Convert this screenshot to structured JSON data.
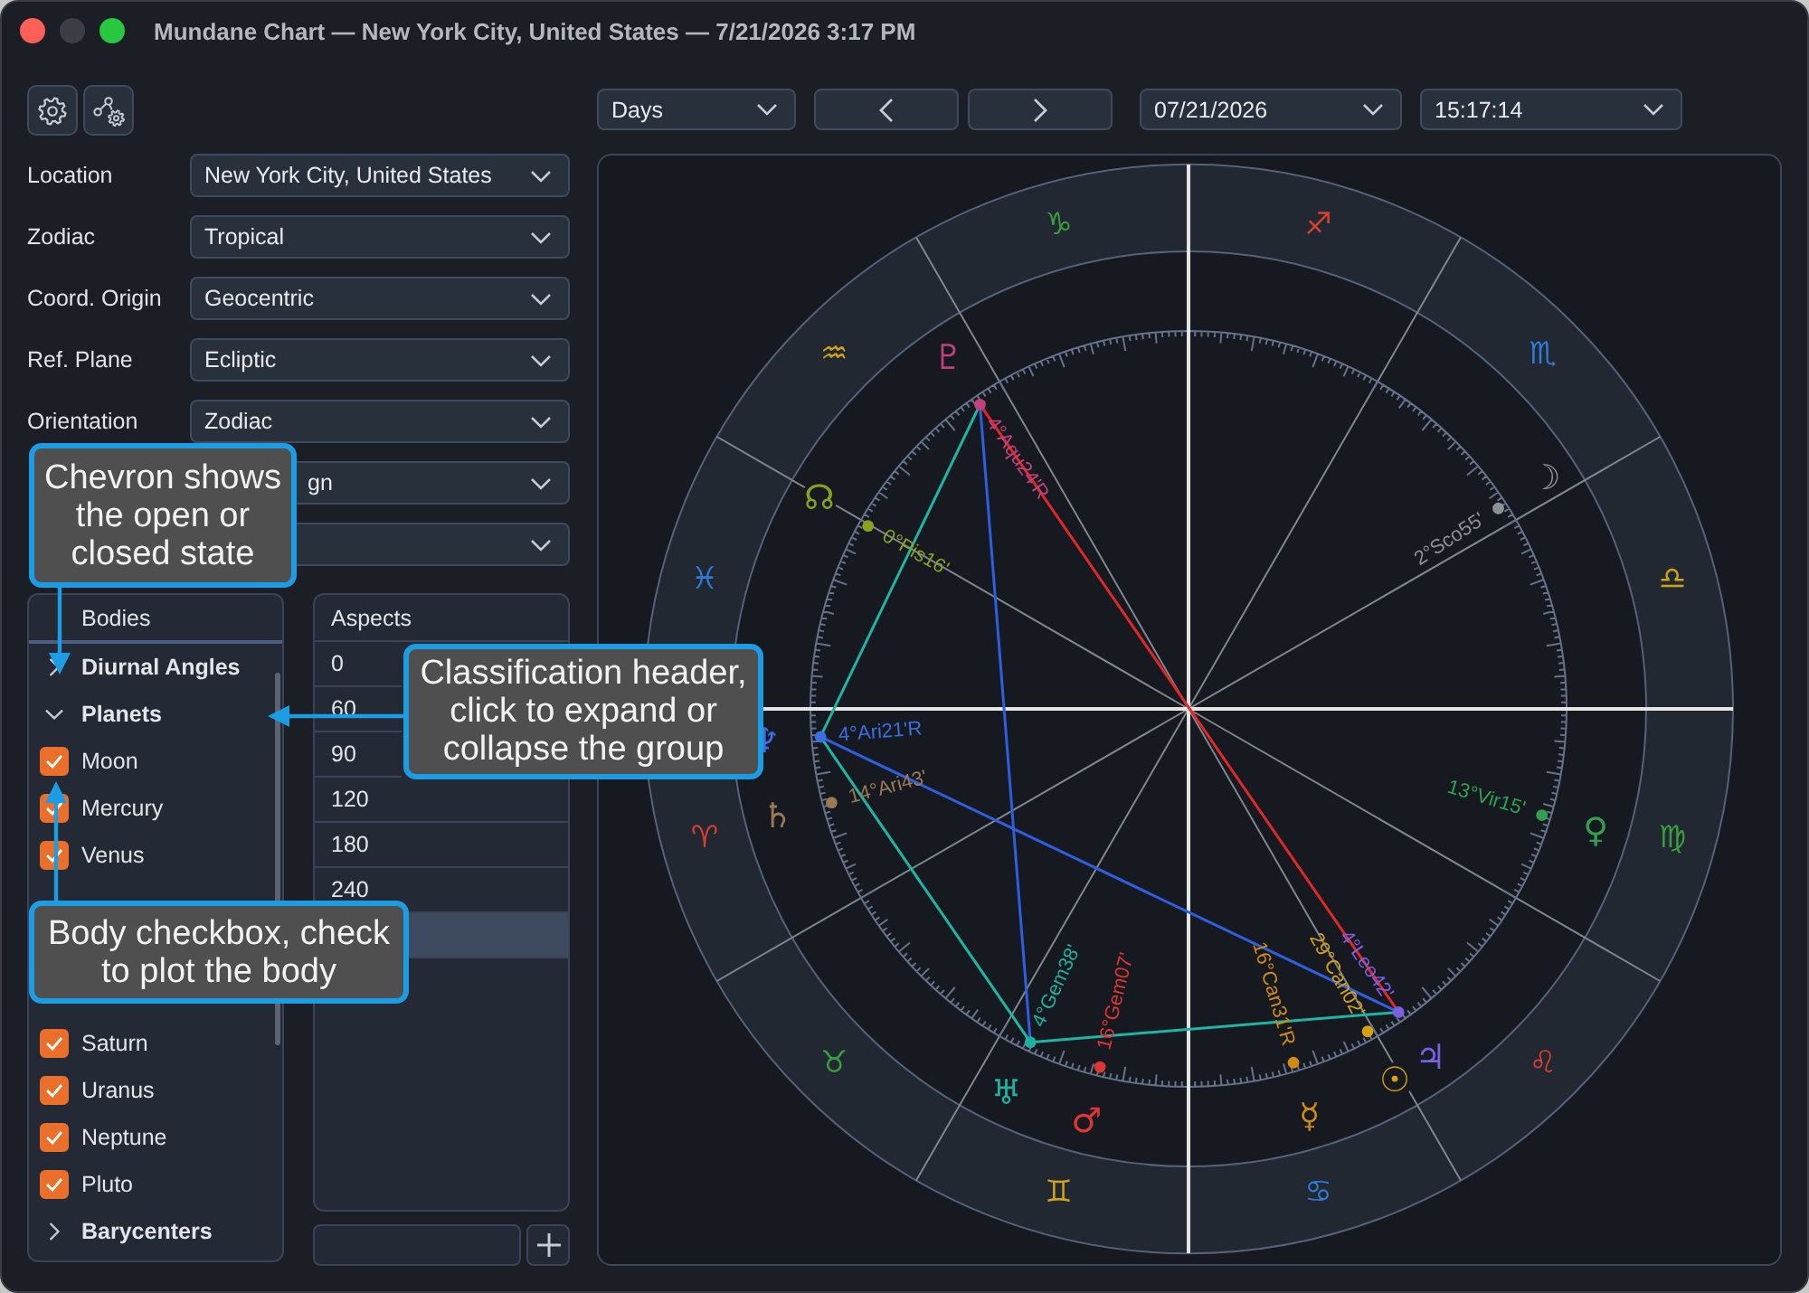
{
  "window": {
    "title": "Mundane Chart — New York City, United States — 7/21/2026 3:17 PM"
  },
  "settings": [
    {
      "kind": "dropdown",
      "label": "Location",
      "value": "New York City, United States"
    },
    {
      "kind": "dropdown",
      "label": "Zodiac",
      "value": "Tropical"
    },
    {
      "kind": "dropdown",
      "label": "Coord. Origin",
      "value": "Geocentric"
    },
    {
      "kind": "dropdown",
      "label": "Ref. Plane",
      "value": "Ecliptic"
    },
    {
      "kind": "dropdown",
      "label": "Orientation",
      "value": "Zodiac"
    },
    {
      "kind": "dropdown",
      "value": "gn"
    },
    {
      "kind": "dropdown"
    }
  ],
  "bodies_panel": {
    "header": "Bodies",
    "groups": [
      {
        "label": "Diurnal Angles",
        "expanded": false
      },
      {
        "label": "Planets",
        "expanded": true,
        "children": [
          {
            "name": "Moon",
            "checked": true
          },
          {
            "name": "Mercury",
            "checked": true
          },
          {
            "name": "Venus",
            "checked": true
          },
          {
            "name": "Saturn",
            "checked": true
          },
          {
            "name": "Uranus",
            "checked": true
          },
          {
            "name": "Neptune",
            "checked": true
          },
          {
            "name": "Pluto",
            "checked": true
          }
        ]
      },
      {
        "label": "Barycenters",
        "expanded": false
      }
    ]
  },
  "aspects_panel": {
    "header": "Aspects",
    "rows": [
      {
        "value": "0",
        "selected": false
      },
      {
        "value": "60",
        "selected": false
      },
      {
        "value": "90",
        "selected": false
      },
      {
        "value": "120",
        "selected": false
      },
      {
        "value": "180",
        "selected": false
      },
      {
        "value": "240",
        "selected": false
      },
      {
        "selected": true
      }
    ]
  },
  "toolbar": {
    "step": "Days",
    "date": "07/21/2026",
    "time": "15:17:14"
  },
  "chart": {
    "signs": [
      {
        "glyph": "♈",
        "color": "#d6402f"
      },
      {
        "glyph": "♉",
        "color": "#3a9d3f"
      },
      {
        "glyph": "♊",
        "color": "#cfa21a"
      },
      {
        "glyph": "♋",
        "color": "#2f7bd6"
      },
      {
        "glyph": "♌",
        "color": "#d6402f"
      },
      {
        "glyph": "♍",
        "color": "#3a9d3f"
      },
      {
        "glyph": "♎",
        "color": "#cfa21a"
      },
      {
        "glyph": "♏",
        "color": "#2f7bd6"
      },
      {
        "glyph": "♐",
        "color": "#d6402f"
      },
      {
        "glyph": "♑",
        "color": "#3a9d3f"
      },
      {
        "glyph": "♒",
        "color": "#cfa21a"
      },
      {
        "glyph": "♓",
        "color": "#2f7bd6"
      }
    ],
    "bodies": [
      {
        "glyph": "♇",
        "label": "4°Aqu24'R",
        "color": "#c0407a"
      },
      {
        "glyph": "☊",
        "label": "0°Pis16'",
        "color": "#8ca020"
      },
      {
        "glyph": "☽",
        "label": "2°Sco55'",
        "color": "#8c9098"
      },
      {
        "glyph": "♆",
        "label": "4°Ari21'R",
        "color": "#3d6ee0"
      },
      {
        "glyph": "♄",
        "label": "14°Ari43'",
        "color": "#9a7a55"
      },
      {
        "glyph": "♀",
        "label": "13°Vir15'",
        "color": "#30a050"
      },
      {
        "glyph": "♅",
        "label": "4°Gem38'",
        "color": "#20b0a0"
      },
      {
        "glyph": "♂",
        "label": "16°Gem07'",
        "color": "#e03535"
      },
      {
        "glyph": "☿",
        "label": "16°Can31'R",
        "color": "#d08a10"
      },
      {
        "glyph": "☉",
        "label": "29°Can02'",
        "color": "#d4a010"
      },
      {
        "glyph": "♃",
        "label": "4°Leo42'",
        "color": "#7860e0"
      }
    ],
    "aspect_lines": [
      {
        "kind": "opposition"
      },
      {
        "kind": "trine"
      },
      {
        "kind": "sextile"
      },
      {
        "kind": "sextile"
      },
      {
        "kind": "sextile"
      },
      {
        "kind": "trine"
      }
    ]
  },
  "callouts": [
    {
      "text": "Chevron shows the open or closed state"
    },
    {
      "text": "Classification header, click to expand or collapse the group"
    },
    {
      "text": "Body checkbox, check to plot the body"
    }
  ]
}
